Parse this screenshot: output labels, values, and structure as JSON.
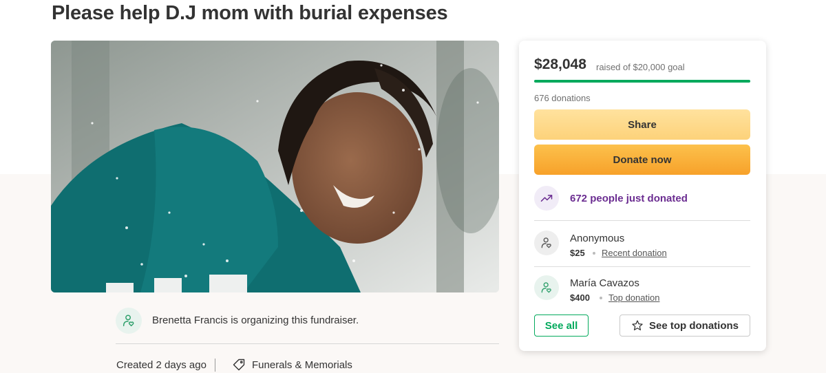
{
  "page": {
    "title": "Please help D.J mom with burial expenses"
  },
  "organizer": {
    "text": "Brenetta Francis is organizing this fundraiser.",
    "created": "Created 2 days ago",
    "category": "Funerals & Memorials"
  },
  "card": {
    "raised": "$28,048",
    "goal": "raised of $20,000 goal",
    "progress_fraction": 1.0,
    "donation_count": "676 donations",
    "share_label": "Share",
    "donate_label": "Donate now",
    "trend_text": "672 people just donated",
    "donors": [
      {
        "name": "Anonymous",
        "amount": "$25",
        "tag": "Recent donation"
      },
      {
        "name": "María Cavazos",
        "amount": "$400",
        "tag": "Top donation"
      }
    ],
    "see_all_label": "See all",
    "see_top_label": "See top donations"
  },
  "colors": {
    "accent_green": "#02a95c",
    "trend_purple": "#6b2d91",
    "donate_orange": "#f7a12a",
    "share_yellow": "#fdd27a"
  },
  "icons": [
    "person-heart-icon",
    "tag-icon",
    "trend-up-icon",
    "star-icon"
  ]
}
